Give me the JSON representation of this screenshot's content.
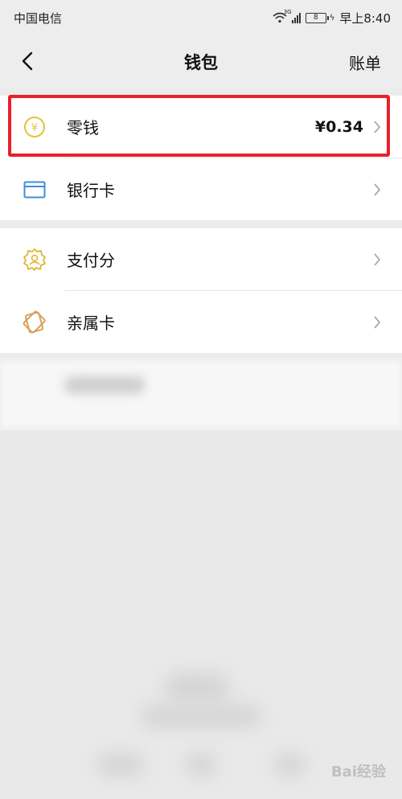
{
  "status_bar": {
    "carrier": "中国电信",
    "network": "3G",
    "battery": "8",
    "time": "早上8:40"
  },
  "header": {
    "title": "钱包",
    "right_link": "账单"
  },
  "wallet_items": [
    {
      "label": "零钱",
      "amount": "¥0.34",
      "icon": "coin-icon"
    },
    {
      "label": "银行卡",
      "icon": "bank-card-icon"
    }
  ],
  "service_items": [
    {
      "label": "支付分",
      "icon": "payment-score-icon"
    },
    {
      "label": "亲属卡",
      "icon": "family-card-icon"
    }
  ],
  "colors": {
    "highlight": "#e8202a",
    "coin": "#e7c13a",
    "bank_card": "#3b8fd6",
    "payment_score": "#e2b334",
    "family_card": "#d9a059"
  },
  "watermark": "Bai经验"
}
